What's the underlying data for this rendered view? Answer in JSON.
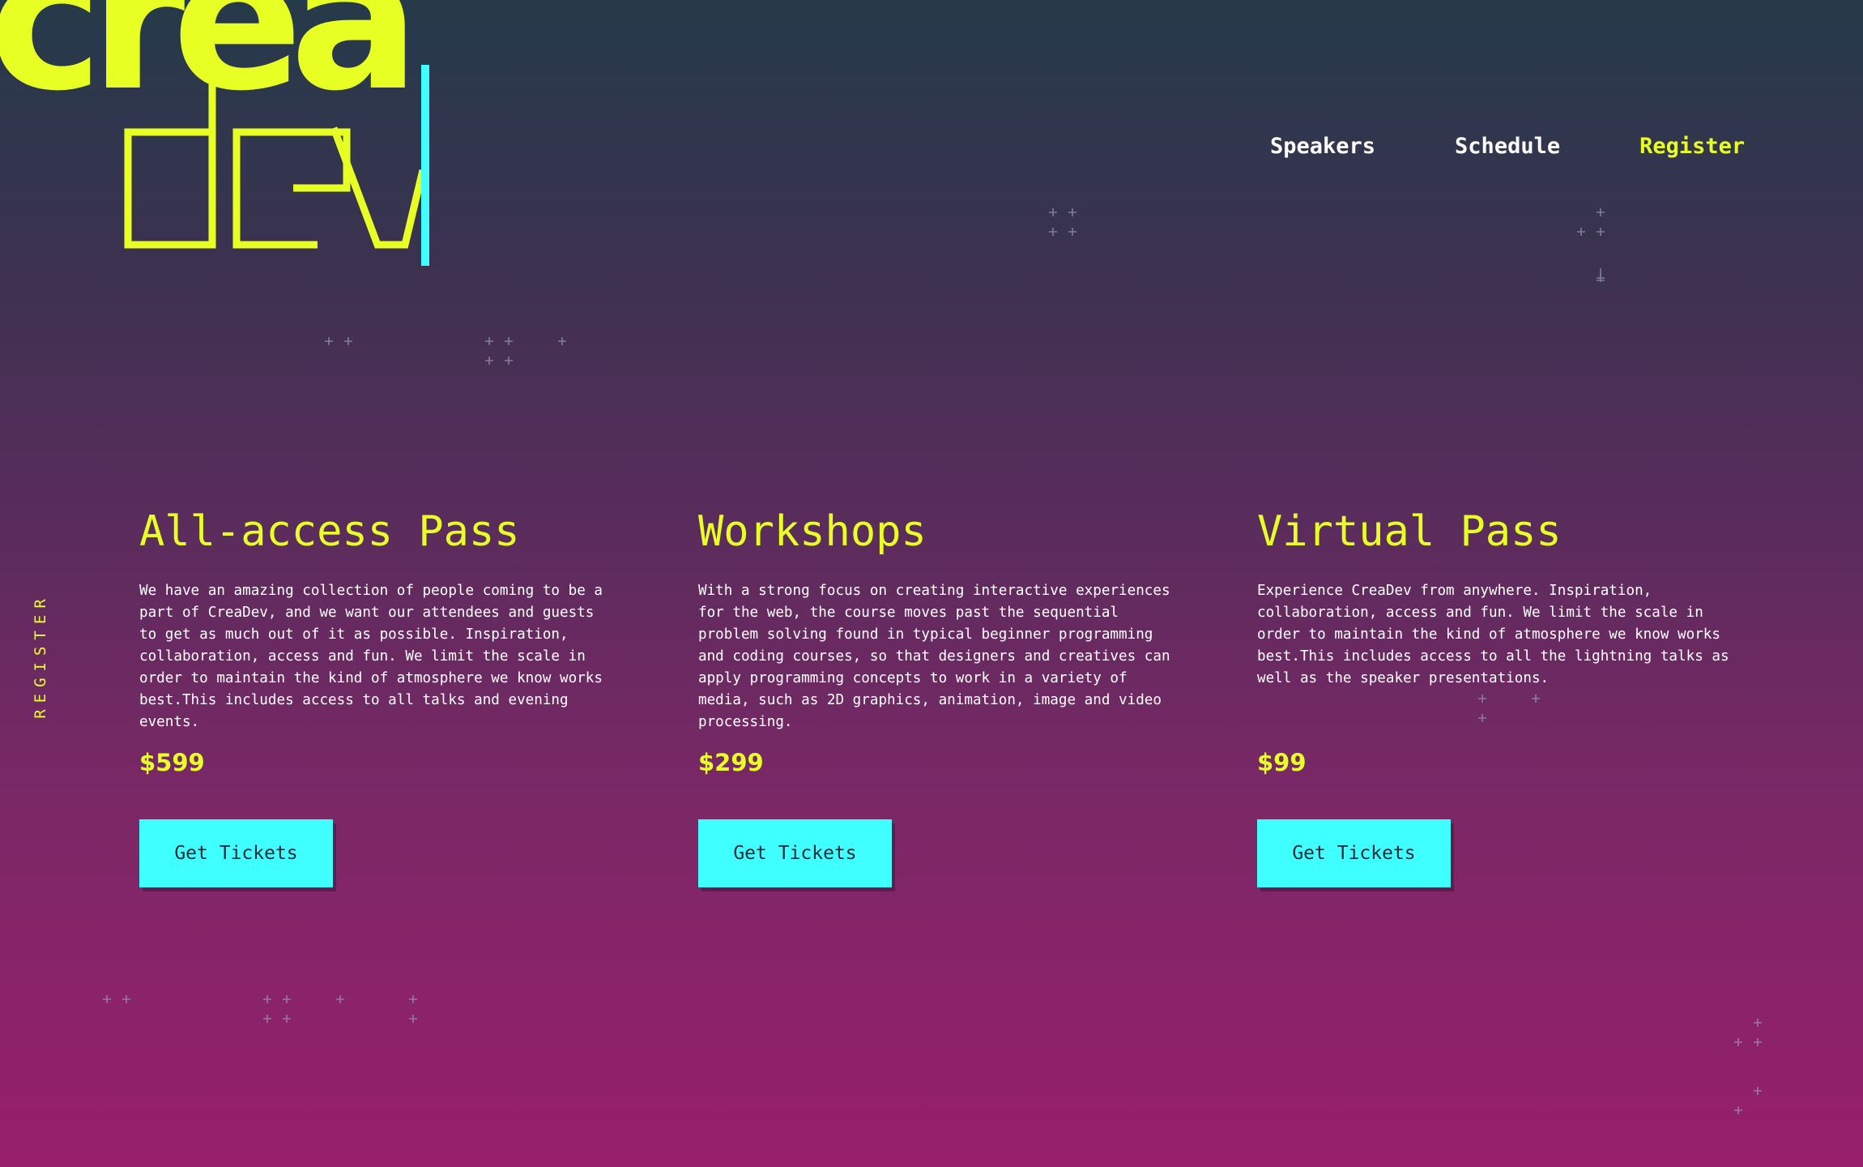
{
  "logo": {
    "top_text": "crea",
    "bottom_text": "dev",
    "brand_color": "#e8ff24",
    "cursor_color": "#40ffff"
  },
  "nav": {
    "items": [
      {
        "label": "Speakers"
      },
      {
        "label": "Schedule"
      },
      {
        "label": "Register",
        "active": true
      }
    ]
  },
  "side_label": "REGISTER",
  "passes": [
    {
      "title": "All-access Pass",
      "description": "We have an amazing collection of people coming to be a part of CreaDev, and we want our attendees and guests to get as much out of it as possible. Inspiration, collaboration, access and fun. We limit the scale in order to maintain the kind of atmosphere we know works best.This includes access to all talks and evening events.",
      "price": "$599",
      "button": "Get Tickets"
    },
    {
      "title": "Workshops",
      "description": "With a strong focus on creating interactive experiences for the web, the course moves past the sequential problem solving found in typical beginner programming and coding courses, so that designers and creatives can apply programming concepts to work in a variety of media, such as 2D graphics, animation, image and video processing.",
      "price": "$299",
      "button": "Get Tickets"
    },
    {
      "title": "Virtual Pass",
      "description": "Experience CreaDev from anywhere. Inspiration, collaboration, access and fun. We limit the scale in order to maintain the kind of atmosphere we know works best.This includes access to all the lightning talks as well as the speaker presentations.",
      "price": "$99",
      "button": "Get Tickets"
    }
  ],
  "colors": {
    "accent_yellow": "#e8ff24",
    "accent_cyan": "#40ffff",
    "gradient_top": "#253a4a",
    "gradient_bottom": "#981f6c"
  }
}
